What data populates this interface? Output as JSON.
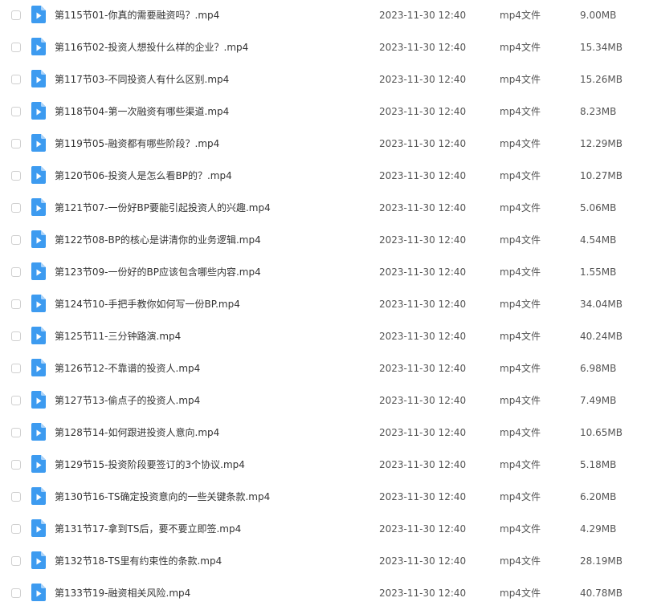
{
  "colors": {
    "icon_blue": "#3d9bf0",
    "icon_fold": "#a9d3fa",
    "text_primary": "#333333",
    "text_secondary": "#555555",
    "checkbox_border": "#cfcfcf"
  },
  "icon": "video-file-icon",
  "files": [
    {
      "name": "第115节01-你真的需要融资吗？.mp4",
      "date": "2023-11-30 12:40",
      "type": "mp4文件",
      "size": "9.00MB"
    },
    {
      "name": "第116节02-投资人想投什么样的企业？.mp4",
      "date": "2023-11-30 12:40",
      "type": "mp4文件",
      "size": "15.34MB"
    },
    {
      "name": "第117节03-不同投资人有什么区别.mp4",
      "date": "2023-11-30 12:40",
      "type": "mp4文件",
      "size": "15.26MB"
    },
    {
      "name": "第118节04-第一次融资有哪些渠道.mp4",
      "date": "2023-11-30 12:40",
      "type": "mp4文件",
      "size": "8.23MB"
    },
    {
      "name": "第119节05-融资都有哪些阶段？.mp4",
      "date": "2023-11-30 12:40",
      "type": "mp4文件",
      "size": "12.29MB"
    },
    {
      "name": "第120节06-投资人是怎么看BP的？.mp4",
      "date": "2023-11-30 12:40",
      "type": "mp4文件",
      "size": "10.27MB"
    },
    {
      "name": "第121节07-一份好BP要能引起投资人的兴趣.mp4",
      "date": "2023-11-30 12:40",
      "type": "mp4文件",
      "size": "5.06MB"
    },
    {
      "name": "第122节08-BP的核心是讲清你的业务逻辑.mp4",
      "date": "2023-11-30 12:40",
      "type": "mp4文件",
      "size": "4.54MB"
    },
    {
      "name": "第123节09-一份好的BP应该包含哪些内容.mp4",
      "date": "2023-11-30 12:40",
      "type": "mp4文件",
      "size": "1.55MB"
    },
    {
      "name": "第124节10-手把手教你如何写一份BP.mp4",
      "date": "2023-11-30 12:40",
      "type": "mp4文件",
      "size": "34.04MB"
    },
    {
      "name": "第125节11-三分钟路演.mp4",
      "date": "2023-11-30 12:40",
      "type": "mp4文件",
      "size": "40.24MB"
    },
    {
      "name": "第126节12-不靠谱的投资人.mp4",
      "date": "2023-11-30 12:40",
      "type": "mp4文件",
      "size": "6.98MB"
    },
    {
      "name": "第127节13-偷点子的投资人.mp4",
      "date": "2023-11-30 12:40",
      "type": "mp4文件",
      "size": "7.49MB"
    },
    {
      "name": "第128节14-如何跟进投资人意向.mp4",
      "date": "2023-11-30 12:40",
      "type": "mp4文件",
      "size": "10.65MB"
    },
    {
      "name": "第129节15-投资阶段要签订的3个协议.mp4",
      "date": "2023-11-30 12:40",
      "type": "mp4文件",
      "size": "5.18MB"
    },
    {
      "name": "第130节16-TS确定投资意向的一些关键条款.mp4",
      "date": "2023-11-30 12:40",
      "type": "mp4文件",
      "size": "6.20MB"
    },
    {
      "name": "第131节17-拿到TS后，要不要立即签.mp4",
      "date": "2023-11-30 12:40",
      "type": "mp4文件",
      "size": "4.29MB"
    },
    {
      "name": "第132节18-TS里有约束性的条款.mp4",
      "date": "2023-11-30 12:40",
      "type": "mp4文件",
      "size": "28.19MB"
    },
    {
      "name": "第133节19-融资相关风险.mp4",
      "date": "2023-11-30 12:40",
      "type": "mp4文件",
      "size": "40.78MB"
    }
  ]
}
